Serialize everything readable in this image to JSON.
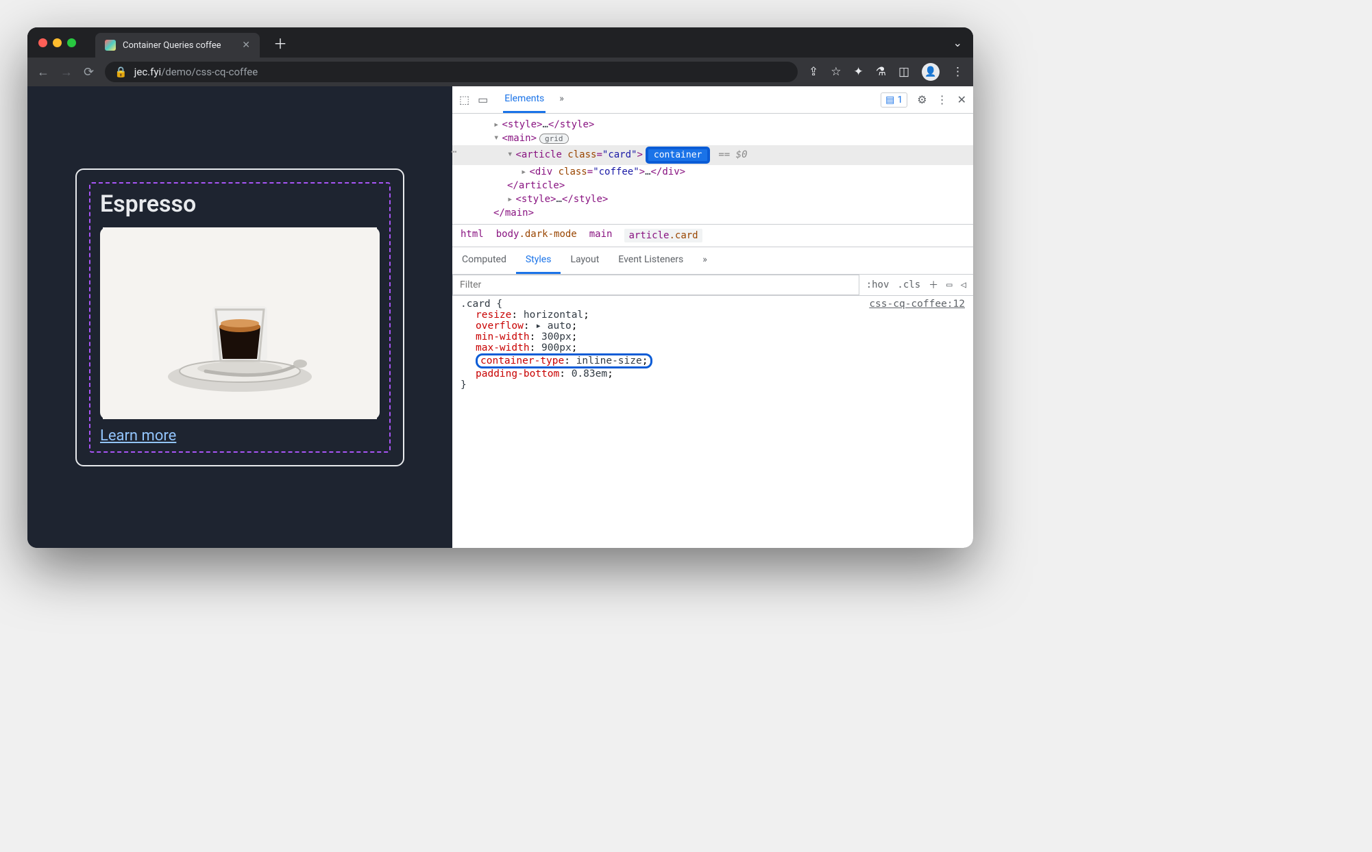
{
  "window": {
    "tab_title": "Container Queries coffee",
    "url_domain": "jec.fyi",
    "url_path": "/demo/css-cq-coffee"
  },
  "page": {
    "card_title": "Espresso",
    "learn_more": "Learn more"
  },
  "devtools": {
    "main_tabs": {
      "elements": "Elements",
      "more": "»"
    },
    "issues_count": "1",
    "dom": {
      "style_open": "<style>",
      "style_mid": "…",
      "style_close": "</style>",
      "main_open": "<main>",
      "grid_badge": "grid",
      "article_open_a": "<article ",
      "article_attr_name": "class",
      "article_attr_val": "\"card\"",
      "article_open_c": ">",
      "container_badge": "container",
      "eq_dollar": "== $0",
      "div_open_a": "<div ",
      "div_attr_name": "class",
      "div_attr_val": "\"coffee\"",
      "div_open_c": ">",
      "div_mid": "…",
      "div_close": "</div>",
      "article_close": "</article>",
      "main_close": "</main>"
    },
    "breadcrumb": {
      "html": "html",
      "body": "body",
      "body_cls": ".dark-mode",
      "main": "main",
      "article": "article",
      "article_cls": ".card"
    },
    "styles_tabs": {
      "computed": "Computed",
      "styles": "Styles",
      "layout": "Layout",
      "events": "Event Listeners",
      "more": "»"
    },
    "filter": {
      "placeholder": "Filter",
      "hov": ":hov",
      "cls": ".cls"
    },
    "rule": {
      "selector": ".card",
      "source": "css-cq-coffee:12",
      "decls": [
        {
          "prop": "resize",
          "val": "horizontal"
        },
        {
          "prop": "overflow",
          "val": "▸ auto"
        },
        {
          "prop": "min-width",
          "val": "300px"
        },
        {
          "prop": "max-width",
          "val": "900px"
        },
        {
          "prop": "container-type",
          "val": "inline-size",
          "highlight": true
        },
        {
          "prop": "padding-bottom",
          "val": "0.83em"
        }
      ]
    }
  }
}
